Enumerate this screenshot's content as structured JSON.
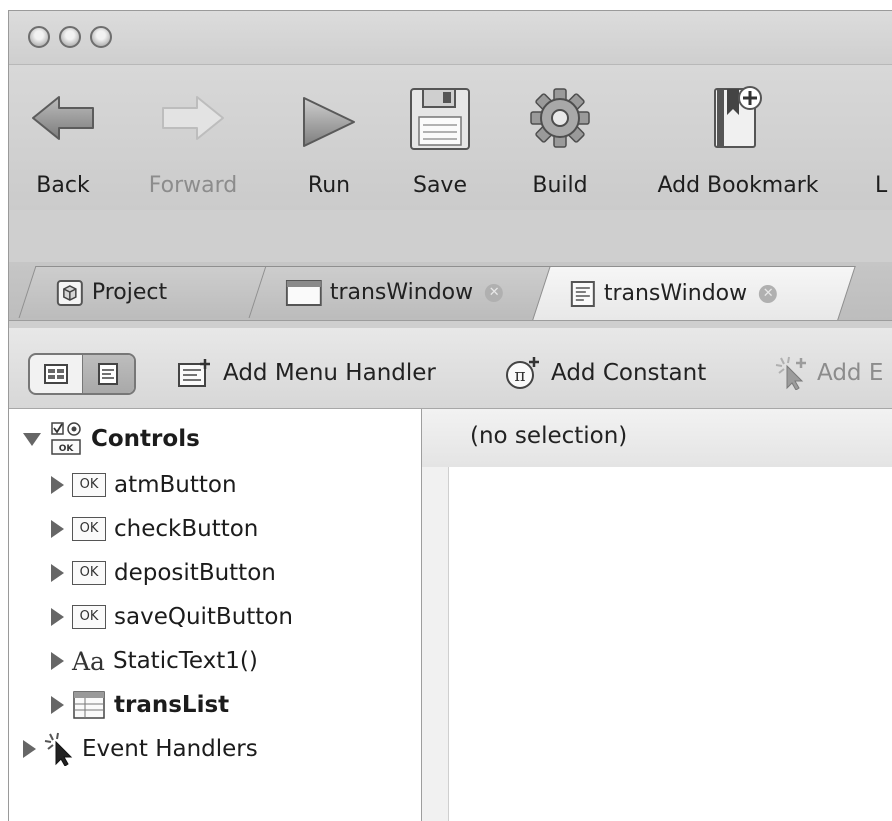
{
  "toolbar": {
    "back_label": "Back",
    "forward_label": "Forward",
    "run_label": "Run",
    "save_label": "Save",
    "build_label": "Build",
    "add_bookmark_label": "Add Bookmark",
    "next_label_partial": "L"
  },
  "tabs": [
    {
      "label": "Project",
      "icon": "project-icon"
    },
    {
      "label": "transWindow",
      "icon": "window-icon",
      "closable": true
    },
    {
      "label": "transWindow",
      "icon": "code-editor-icon",
      "closable": true,
      "active": true
    }
  ],
  "subtoolbar": {
    "add_menu_handler": "Add Menu Handler",
    "add_constant": "Add Constant",
    "add_event_partial": "Add E"
  },
  "tree": {
    "controls": {
      "label": "Controls",
      "items": [
        {
          "label": "atmButton",
          "icon": "ok-button-icon"
        },
        {
          "label": "checkButton",
          "icon": "ok-button-icon"
        },
        {
          "label": "depositButton",
          "icon": "ok-button-icon"
        },
        {
          "label": "saveQuitButton",
          "icon": "ok-button-icon"
        },
        {
          "label": "StaticText1()",
          "icon": "static-text-icon",
          "icon_text": "Aa"
        },
        {
          "label": "transList",
          "icon": "listbox-icon",
          "bold": true
        }
      ]
    },
    "event_handlers": {
      "label": "Event Handlers"
    }
  },
  "ok_icon_text": "OK",
  "detail": {
    "header": "(no selection)"
  },
  "colors": {
    "chrome": "#cfcfcf",
    "active_tab": "#eeeeee",
    "icon_gray": "#8a8a8a"
  }
}
